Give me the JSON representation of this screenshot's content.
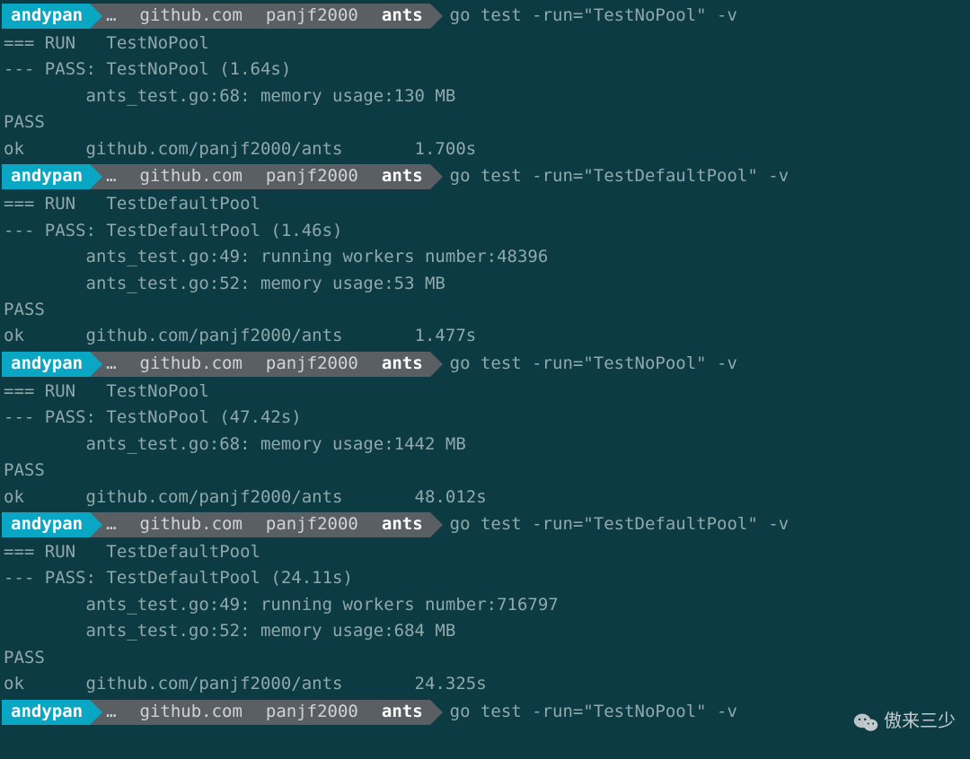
{
  "prompt": {
    "user": "andypan",
    "ellipsis": "…",
    "path1": "github.com",
    "path2": "panjf2000",
    "path3": "ants"
  },
  "blocks": [
    {
      "command": "go test -run=\"TestNoPool\" -v",
      "lines": [
        "=== RUN   TestNoPool",
        "--- PASS: TestNoPool (1.64s)",
        "        ants_test.go:68: memory usage:130 MB",
        "PASS",
        "ok      github.com/panjf2000/ants       1.700s"
      ]
    },
    {
      "command": "go test -run=\"TestDefaultPool\" -v",
      "lines": [
        "=== RUN   TestDefaultPool",
        "--- PASS: TestDefaultPool (1.46s)",
        "        ants_test.go:49: running workers number:48396",
        "        ants_test.go:52: memory usage:53 MB",
        "PASS",
        "ok      github.com/panjf2000/ants       1.477s"
      ]
    },
    {
      "command": "go test -run=\"TestNoPool\" -v",
      "lines": [
        "=== RUN   TestNoPool",
        "--- PASS: TestNoPool (47.42s)",
        "        ants_test.go:68: memory usage:1442 MB",
        "PASS",
        "ok      github.com/panjf2000/ants       48.012s"
      ]
    },
    {
      "command": "go test -run=\"TestDefaultPool\" -v",
      "lines": [
        "=== RUN   TestDefaultPool",
        "--- PASS: TestDefaultPool (24.11s)",
        "        ants_test.go:49: running workers number:716797",
        "        ants_test.go:52: memory usage:684 MB",
        "PASS",
        "ok      github.com/panjf2000/ants       24.325s"
      ]
    },
    {
      "command": "go test -run=\"TestNoPool\" -v",
      "lines": []
    }
  ],
  "watermark": "傲来三少"
}
